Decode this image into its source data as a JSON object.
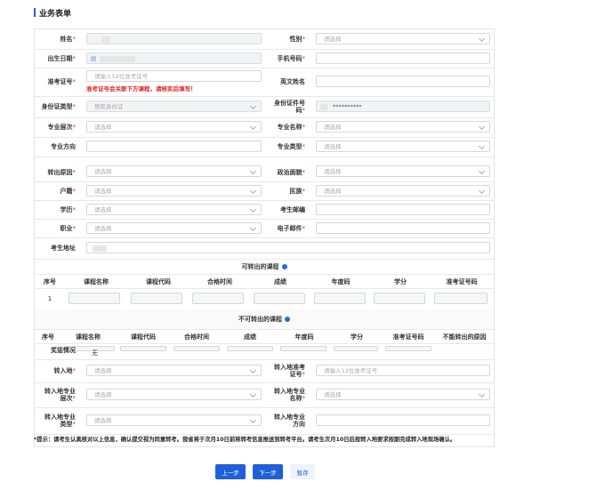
{
  "page_title": "业务表单",
  "colors": {
    "accent": "#1f5fd9",
    "required": "#e03030"
  },
  "fields": {
    "name_label": "姓名",
    "gender_label": "性别",
    "gender_ph": "请选择",
    "birth_label": "出生日期",
    "phone_label": "手机号码",
    "exam_label": "准考证号",
    "exam_ph": "请输入12位准考证号",
    "exam_error": "准考证号会关联下方课程，请核实后填写！",
    "english_name_label": "英文姓名",
    "idtype_label": "身份证类型",
    "idtype_value": "居民身份证",
    "idno_label_1": "身份证件号",
    "idno_label_2": "码",
    "idno_value": "**********",
    "level_label": "专业层次",
    "level_ph": "请选择",
    "major_name_label": "专业名称",
    "major_name_ph": "请选择",
    "direction_label": "专业方向",
    "major_type_label": "专业类型",
    "major_type_ph": "请选择",
    "reason_label": "转出原因",
    "reason_ph": "请选择",
    "political_label": "政治面貌",
    "political_ph": "请选择",
    "hukou_label": "户籍",
    "hukou_ph": "请选择",
    "ethnic_label": "民族",
    "ethnic_ph": "请选择",
    "edu_label": "学历",
    "edu_ph": "请选择",
    "zip_label": "考生邮编",
    "job_label": "职业",
    "job_ph": "请选择",
    "email_label": "电子邮件",
    "address_label": "考生地址"
  },
  "transferable": {
    "title": "可转出的课程",
    "headers": [
      "序号",
      "课程名称",
      "课程代码",
      "合格时间",
      "成绩",
      "年度码",
      "学分",
      "准考证号码"
    ],
    "rows": [
      {
        "index": "1"
      }
    ]
  },
  "non_transferable": {
    "title": "不可转出的课程",
    "headers": [
      "序号",
      "课程名称",
      "课程代码",
      "合格时间",
      "成绩",
      "年度码",
      "学分",
      "准考证号码",
      "不能转出的原因"
    ]
  },
  "lower": {
    "punish_label": "奖惩情况",
    "punish_value": "无",
    "dest_label": "转入地",
    "dest_ph": "请选择",
    "dest_exam_label_1": "转入地准考",
    "dest_exam_label_2": "证号",
    "dest_exam_ph": "请输入12位准考证号",
    "dest_level_label_1": "转入地专业",
    "dest_level_label_2": "层次",
    "dest_level_ph": "请选择",
    "dest_major_label_1": "转入地专业",
    "dest_major_label_2": "名称",
    "dest_major_ph": "请选择",
    "dest_type_label_1": "转入地专业",
    "dest_type_label_2": "类型",
    "dest_type_ph": "请选择",
    "dest_dir_label_1": "转入地专业",
    "dest_dir_label_2": "方向"
  },
  "tip": "*提示：请考生认真核对以上信息，确认提交视为同意转考。我省将于次月10日前将转考信息推送到转考平台。请考生次月10日后按转入地要求按期完成转入地现场确认。",
  "buttons": {
    "prev": "上一步",
    "next": "下一步",
    "save": "暂存"
  }
}
